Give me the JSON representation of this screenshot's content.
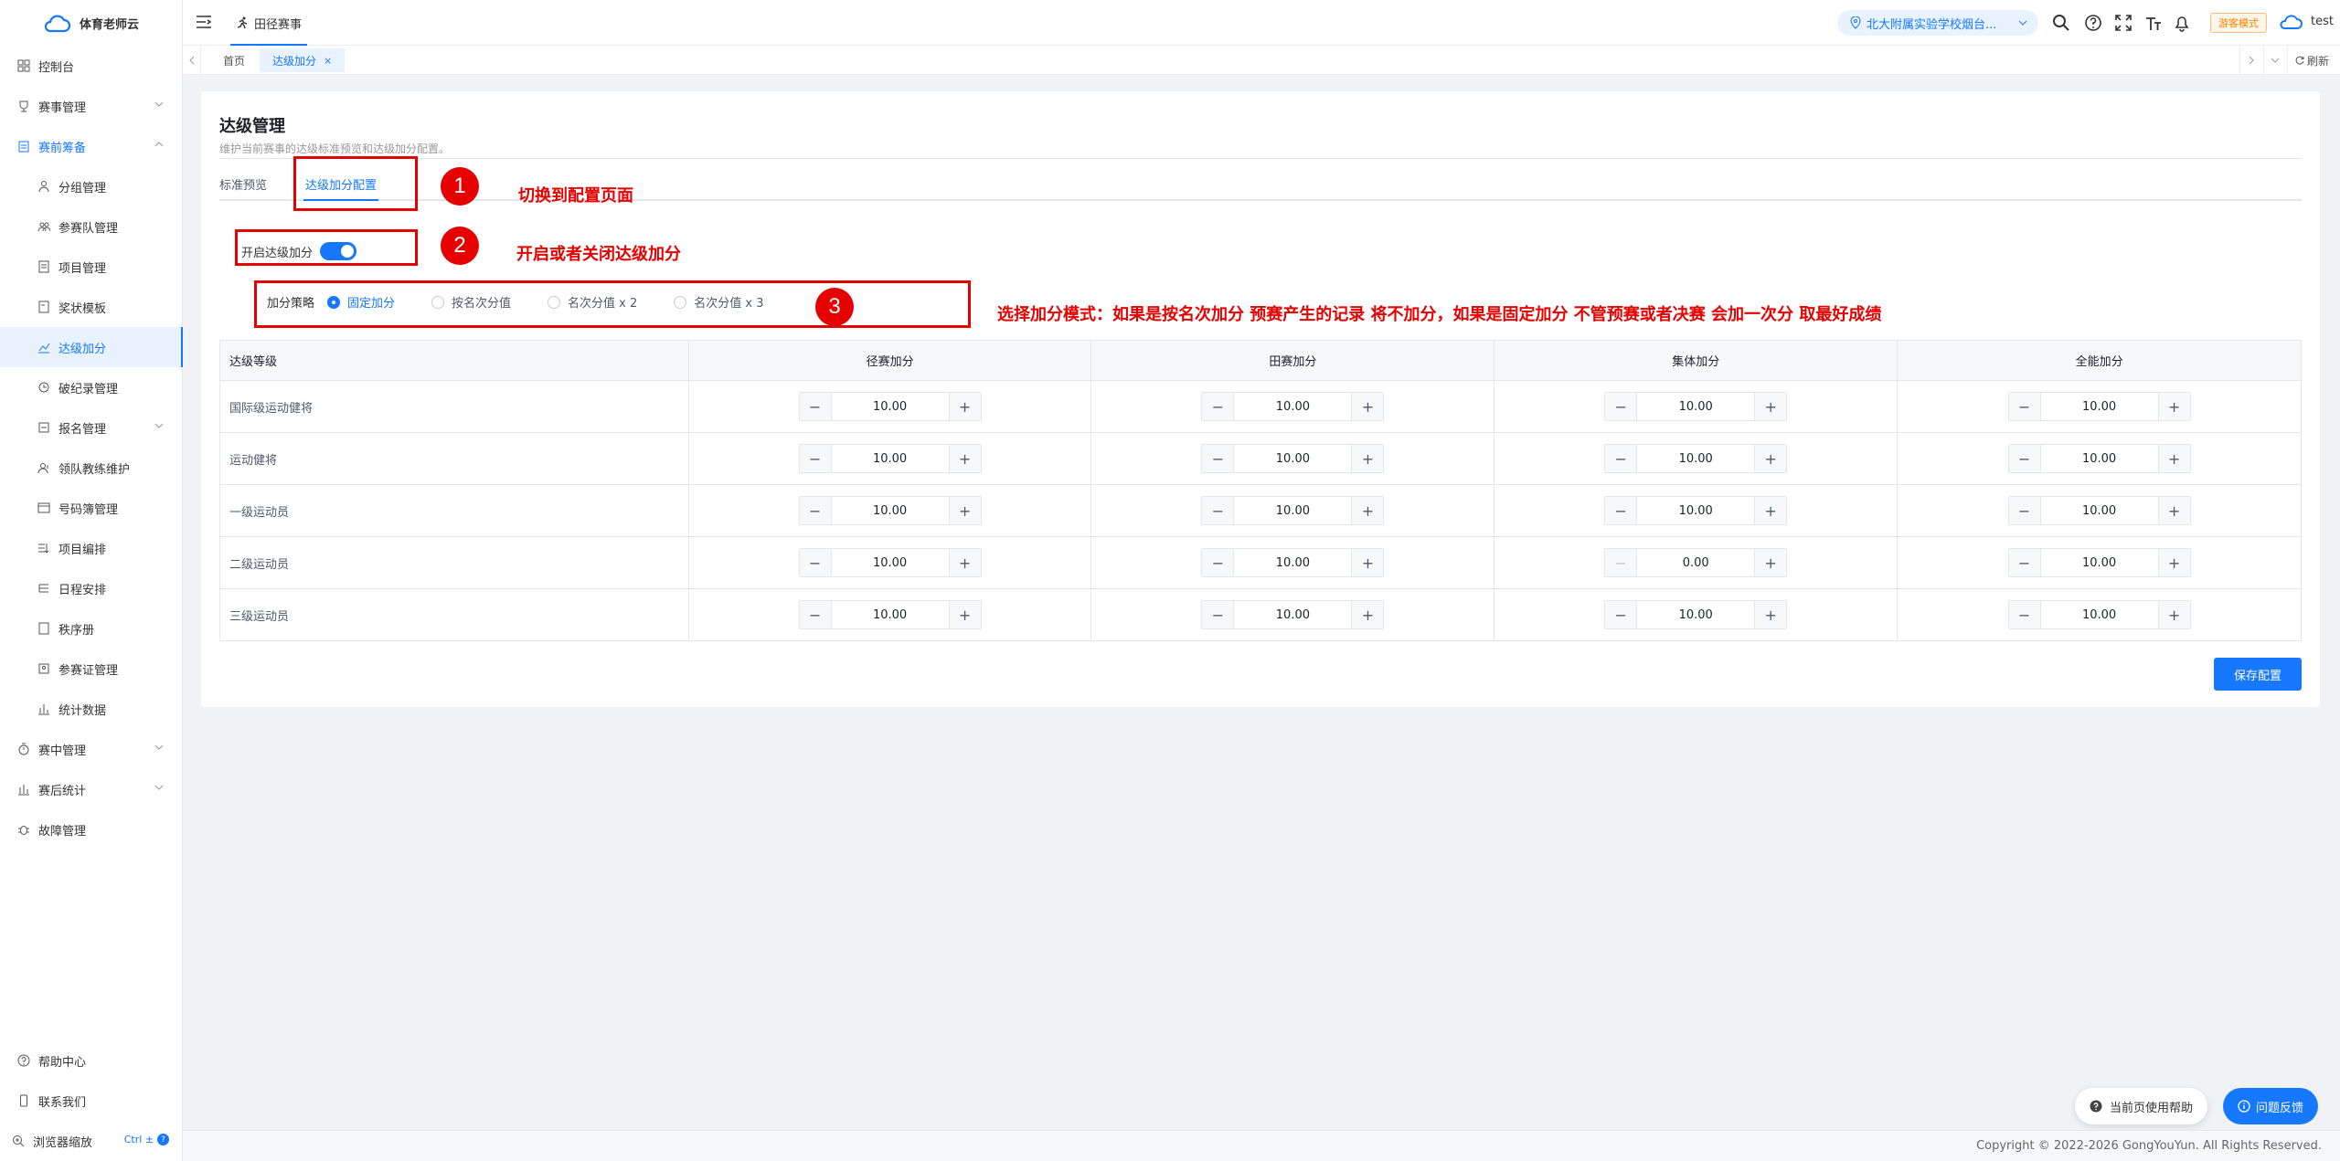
{
  "app": {
    "name": "体育老师云"
  },
  "sidebar": {
    "items": [
      {
        "label": "控制台",
        "icon": "dashboard-icon"
      },
      {
        "label": "赛事管理",
        "icon": "trophy-icon"
      },
      {
        "label": "赛前筹备",
        "icon": "clipboard-icon"
      },
      {
        "label": "分组管理",
        "icon": "group-icon"
      },
      {
        "label": "参赛队管理",
        "icon": "team-icon"
      },
      {
        "label": "项目管理",
        "icon": "file-icon"
      },
      {
        "label": "奖状模板",
        "icon": "certificate-icon"
      },
      {
        "label": "达级加分",
        "icon": "chart-line-icon"
      },
      {
        "label": "破纪录管理",
        "icon": "record-icon"
      },
      {
        "label": "报名管理",
        "icon": "signup-icon"
      },
      {
        "label": "领队教练维护",
        "icon": "coach-icon"
      },
      {
        "label": "号码簿管理",
        "icon": "bib-icon"
      },
      {
        "label": "项目编排",
        "icon": "schedule-list-icon"
      },
      {
        "label": "日程安排",
        "icon": "calendar-icon"
      },
      {
        "label": "秩序册",
        "icon": "book-icon"
      },
      {
        "label": "参赛证管理",
        "icon": "badge-icon"
      },
      {
        "label": "统计数据",
        "icon": "stats-icon"
      },
      {
        "label": "赛中管理",
        "icon": "timer-icon"
      },
      {
        "label": "赛后统计",
        "icon": "bar-chart-icon"
      },
      {
        "label": "故障管理",
        "icon": "bug-icon"
      }
    ],
    "bottom": {
      "help": "帮助中心",
      "contact": "联系我们",
      "zoom": "浏览器缩放",
      "zoom_hint": "Ctrl ±"
    }
  },
  "header": {
    "tab": "田径赛事",
    "school": "北大附属实验学校烟台...",
    "guest_badge": "游客模式",
    "user": "test"
  },
  "tagbar": {
    "home": "首页",
    "current": "达级加分",
    "close": "×",
    "refresh": "刷新"
  },
  "page": {
    "title": "达级管理",
    "desc": "维护当前赛事的达级标准预览和达级加分配置。",
    "tabs": [
      "标准预览",
      "达级加分配置"
    ],
    "toggle_label": "开启达级加分",
    "toggle_on": true,
    "strategy_label": "加分策略",
    "strategies": [
      "固定加分",
      "按名次分值",
      "名次分值 x 2",
      "名次分值 x 3"
    ],
    "strategy_selected": 0,
    "save": "保存配置"
  },
  "table": {
    "headers": [
      "达级等级",
      "径赛加分",
      "田赛加分",
      "集体加分",
      "全能加分"
    ],
    "rows": [
      {
        "level": "国际级运动健将",
        "values": [
          "10.00",
          "10.00",
          "10.00",
          "10.00"
        ]
      },
      {
        "level": "运动健将",
        "values": [
          "10.00",
          "10.00",
          "10.00",
          "10.00"
        ]
      },
      {
        "level": "一级运动员",
        "values": [
          "10.00",
          "10.00",
          "10.00",
          "10.00"
        ]
      },
      {
        "level": "二级运动员",
        "values": [
          "10.00",
          "10.00",
          "0.00",
          "10.00"
        ]
      },
      {
        "level": "三级运动员",
        "values": [
          "10.00",
          "10.00",
          "10.00",
          "10.00"
        ]
      }
    ],
    "minus": "−",
    "plus": "+"
  },
  "annotations": [
    {
      "num": "1",
      "text": "切换到配置页面"
    },
    {
      "num": "2",
      "text": "开启或者关闭达级加分"
    },
    {
      "num": "3",
      "text": "选择加分模式：如果是按名次加分 预赛产生的记录 将不加分，如果是固定加分 不管预赛或者决赛 会加一次分 取最好成绩"
    }
  ],
  "floating": {
    "help": "当前页使用帮助",
    "feedback": "问题反馈"
  },
  "footer": {
    "copyright": "Copyright © 2022-2026 GongYouYun. All Rights Reserved."
  },
  "colors": {
    "primary": "#1677ff",
    "annotation": "#e60000"
  }
}
